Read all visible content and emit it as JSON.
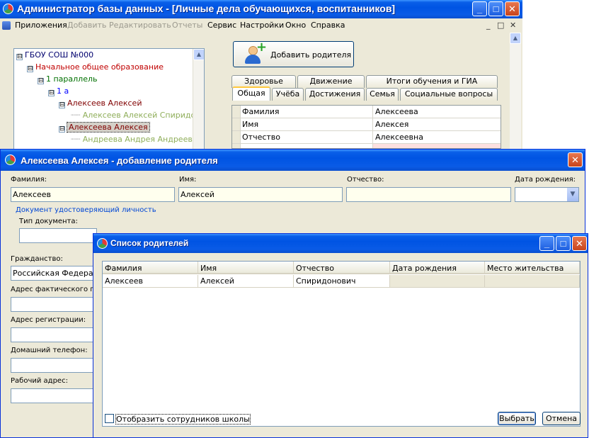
{
  "main": {
    "title": "Администратор базы данных - [Личные дела обучающихся, воспитанников]",
    "menu": [
      "Приложения",
      "Добавить",
      "Редактировать",
      "Отчеты",
      "Сервис",
      "Настройки",
      "Окно",
      "Справка"
    ],
    "menu_disabled": [
      false,
      true,
      true,
      true,
      false,
      false,
      false,
      false
    ],
    "mdi_buttons": [
      "_",
      "□",
      "✕"
    ],
    "tree": [
      {
        "label": "ГБОУ СОШ №000",
        "toggle": "⊟"
      },
      {
        "label": "Начальное общее образование",
        "toggle": "⊟"
      },
      {
        "label": "1 параллель",
        "toggle": "⊟"
      },
      {
        "label": "1 а",
        "toggle": "⊟"
      },
      {
        "label": "Алексеев Алексей",
        "toggle": "⊟"
      },
      {
        "label": "Алексеев Алексей Спиридонович",
        "toggle": ""
      },
      {
        "label": "Алексеева Алексея",
        "toggle": "⊟"
      },
      {
        "label": "Андреева Андрея Андреевна",
        "toggle": ""
      }
    ],
    "add_parent_button": "Добавить родителя",
    "tabs_top": [
      "Здоровье",
      "Движение",
      "Итоги обучения и ГИА"
    ],
    "tabs_bottom": [
      "Общая",
      "Учёба",
      "Достижения",
      "Семья",
      "Социальные вопросы"
    ],
    "grid": [
      {
        "field": "Фамилия",
        "value": "Алексеева"
      },
      {
        "field": "Имя",
        "value": "Алексея"
      },
      {
        "field": "Отчество",
        "value": "Алексеевна"
      }
    ]
  },
  "dialog1": {
    "title": "Алексеева Алексея - добавление родителя",
    "labels": {
      "last_name": "Фамилия:",
      "first_name": "Имя:",
      "patronymic": "Отчество:",
      "birth_date": "Дата рождения:",
      "id_document": "Документ удостоверяющий личность",
      "doc_type": "Тип документа:",
      "citizenship": "Гражданство:",
      "actual_address": "Адрес фактического пр",
      "registration_address": "Адрес регистрации:",
      "home_phone": "Домашний телефон:",
      "work_address": "Рабочий адрес:"
    },
    "values": {
      "last_name": "Алексеев",
      "first_name": "Алексей",
      "patronymic": "",
      "birth_date": "",
      "doc_type": "",
      "citizenship": "Российская Федерация",
      "actual_address": "",
      "registration_address": "",
      "home_phone": "",
      "work_address": ""
    }
  },
  "dialog2": {
    "title": "Список родителей",
    "columns": [
      "Фамилия",
      "Имя",
      "Отчество",
      "Дата рождения",
      "Место жительства"
    ],
    "rows": [
      [
        "Алексеев",
        "Алексей",
        "Спиридонович",
        "",
        ""
      ]
    ],
    "show_staff_checkbox": "Отобразить сотрудников школы",
    "show_staff_checked": false,
    "select_button": "Выбрать",
    "cancel_button": "Отмена"
  }
}
